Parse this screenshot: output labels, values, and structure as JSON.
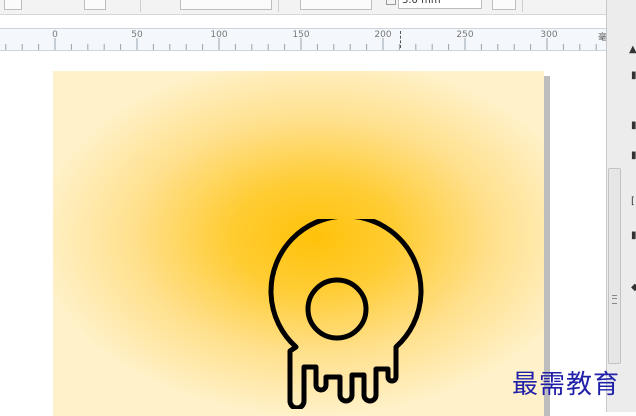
{
  "toolbar": {
    "value_field": "3.0 mm",
    "field_icon": "ruler-outline-icon"
  },
  "ruler": {
    "labels": [
      "0",
      "50",
      "100",
      "150",
      "200",
      "250",
      "300"
    ],
    "unit": "毫米"
  },
  "canvas": {
    "background_colors": [
      "#ffc20a",
      "#fff1c9"
    ],
    "artwork": {
      "description_icon": "dripping-ring-icon",
      "stroke_color": "#000000"
    }
  },
  "watermark": {
    "text": "最需教育"
  }
}
